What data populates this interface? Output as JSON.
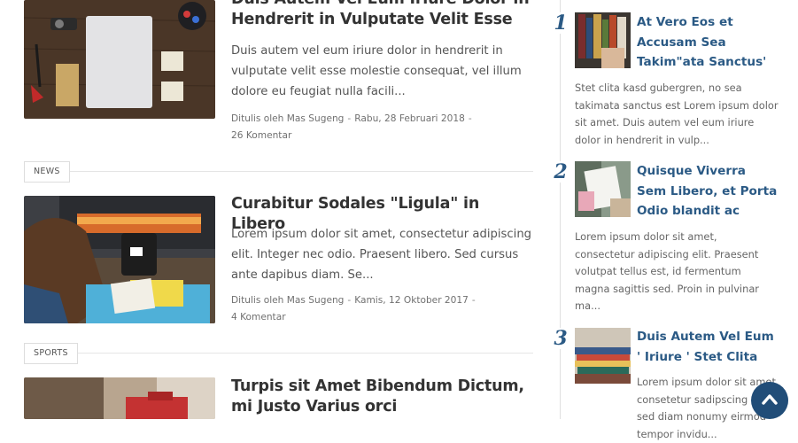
{
  "posts": [
    {
      "title": "Duis Autem Vel Eum Iriure Dolor in Hendrerit in Vulputate Velit Esse",
      "excerpt": "Duis autem vel eum iriure dolor in hendrerit in vulputate velit esse molestie consequat, vel illum dolore eu feugiat nulla facili...",
      "author": "Ditulis oleh Mas Sugeng",
      "date": "Rabu, 28 Februari 2018",
      "comments": "26 Komentar",
      "image": "desk-flatlay-image"
    },
    {
      "category": "NEWS",
      "title": "Curabitur Sodales \"Ligula\" in Libero",
      "excerpt": "Lorem ipsum dolor sit amet, consectetur adipiscing elit. Integer nec odio. Praesent libero. Sed cursus ante dapibus diam. Se...",
      "author": "Ditulis oleh Mas Sugeng",
      "date": "Kamis, 12 Oktober 2017",
      "comments": "4 Komentar",
      "image": "boots-mug-image"
    },
    {
      "category": "SPORTS",
      "title": "Turpis sit Amet Bibendum Dictum, mi Justo Varius orci",
      "image": "red-camera-image"
    }
  ],
  "separator": "-",
  "sidebar": {
    "items": [
      {
        "number": "1",
        "title": "At Vero Eos et Accusam Sea Takim\"ata Sanctus'",
        "excerpt": "Stet clita kasd gubergren, no sea takimata sanctus est Lorem ipsum dolor sit amet. Duis autem vel eum iriure dolor in hendrerit in vulp..."
      },
      {
        "number": "2",
        "title": "Quisque Viverra Sem Libero, et Porta Odio blandit ac",
        "excerpt": "Lorem ipsum dolor sit amet, consectetur adipiscing elit. Praesent volutpat tellus est, id fermentum magna sagittis sed. Proin in pulvinar ma..."
      },
      {
        "number": "3",
        "title": "Duis Autem Vel Eum ' Iriure ' Stet Clita",
        "excerpt": "Lorem ipsum dolor sit amet, consetetur sadipscing elitr, sed diam nonumy eirmod tempor invidu..."
      }
    ]
  },
  "colors": {
    "title": "#333333",
    "link": "#2b5a85",
    "scroll_top_button": "#214d78"
  },
  "icons": {
    "scroll_top": "chevron-up-icon"
  }
}
